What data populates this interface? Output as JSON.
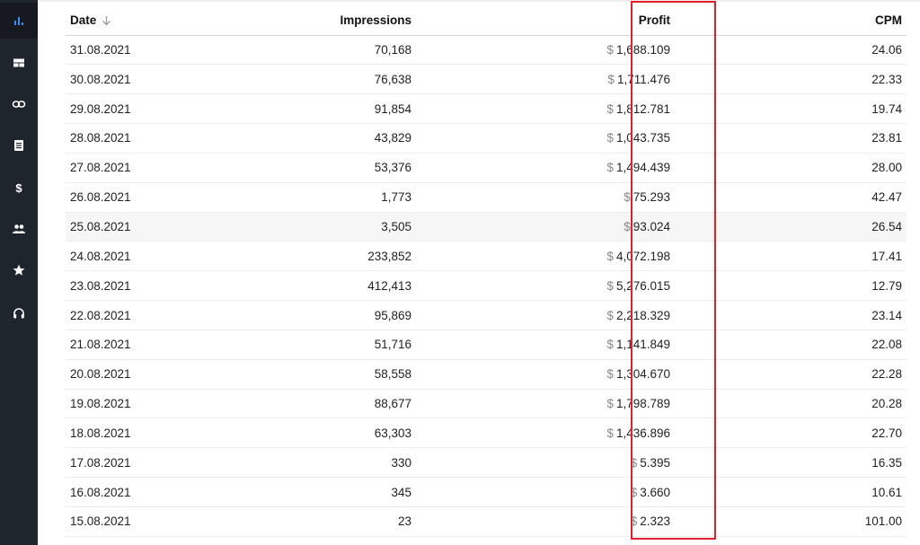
{
  "sidebar": {
    "items": [
      {
        "icon": "bar-chart-icon",
        "active": true
      },
      {
        "icon": "dashboard-icon",
        "active": false
      },
      {
        "icon": "link-icon",
        "active": false
      },
      {
        "icon": "document-icon",
        "active": false
      },
      {
        "icon": "dollar-icon",
        "active": false
      },
      {
        "icon": "users-icon",
        "active": false
      },
      {
        "icon": "star-icon",
        "active": false
      },
      {
        "icon": "headset-icon",
        "active": false
      }
    ],
    "active_color": "#3d8ef0",
    "icon_color": "#ffffff"
  },
  "table": {
    "columns": {
      "date": "Date",
      "impressions": "Impressions",
      "profit": "Profit",
      "cpm": "CPM"
    },
    "currency_symbol": "$",
    "rows": [
      {
        "date": "31.08.2021",
        "impressions": "70,168",
        "profit": "1,688.109",
        "cpm": "24.06"
      },
      {
        "date": "30.08.2021",
        "impressions": "76,638",
        "profit": "1,711.476",
        "cpm": "22.33"
      },
      {
        "date": "29.08.2021",
        "impressions": "91,854",
        "profit": "1,812.781",
        "cpm": "19.74"
      },
      {
        "date": "28.08.2021",
        "impressions": "43,829",
        "profit": "1,043.735",
        "cpm": "23.81"
      },
      {
        "date": "27.08.2021",
        "impressions": "53,376",
        "profit": "1,494.439",
        "cpm": "28.00"
      },
      {
        "date": "26.08.2021",
        "impressions": "1,773",
        "profit": "75.293",
        "cpm": "42.47"
      },
      {
        "date": "25.08.2021",
        "impressions": "3,505",
        "profit": "93.024",
        "cpm": "26.54"
      },
      {
        "date": "24.08.2021",
        "impressions": "233,852",
        "profit": "4,072.198",
        "cpm": "17.41"
      },
      {
        "date": "23.08.2021",
        "impressions": "412,413",
        "profit": "5,276.015",
        "cpm": "12.79"
      },
      {
        "date": "22.08.2021",
        "impressions": "95,869",
        "profit": "2,218.329",
        "cpm": "23.14"
      },
      {
        "date": "21.08.2021",
        "impressions": "51,716",
        "profit": "1,141.849",
        "cpm": "22.08"
      },
      {
        "date": "20.08.2021",
        "impressions": "58,558",
        "profit": "1,304.670",
        "cpm": "22.28"
      },
      {
        "date": "19.08.2021",
        "impressions": "88,677",
        "profit": "1,798.789",
        "cpm": "20.28"
      },
      {
        "date": "18.08.2021",
        "impressions": "63,303",
        "profit": "1,436.896",
        "cpm": "22.70"
      },
      {
        "date": "17.08.2021",
        "impressions": "330",
        "profit": "5.395",
        "cpm": "16.35"
      },
      {
        "date": "16.08.2021",
        "impressions": "345",
        "profit": "3.660",
        "cpm": "10.61"
      },
      {
        "date": "15.08.2021",
        "impressions": "23",
        "profit": "2.323",
        "cpm": "101.00"
      }
    ],
    "hovered_row": 6,
    "highlight_color": "#e0212b"
  }
}
